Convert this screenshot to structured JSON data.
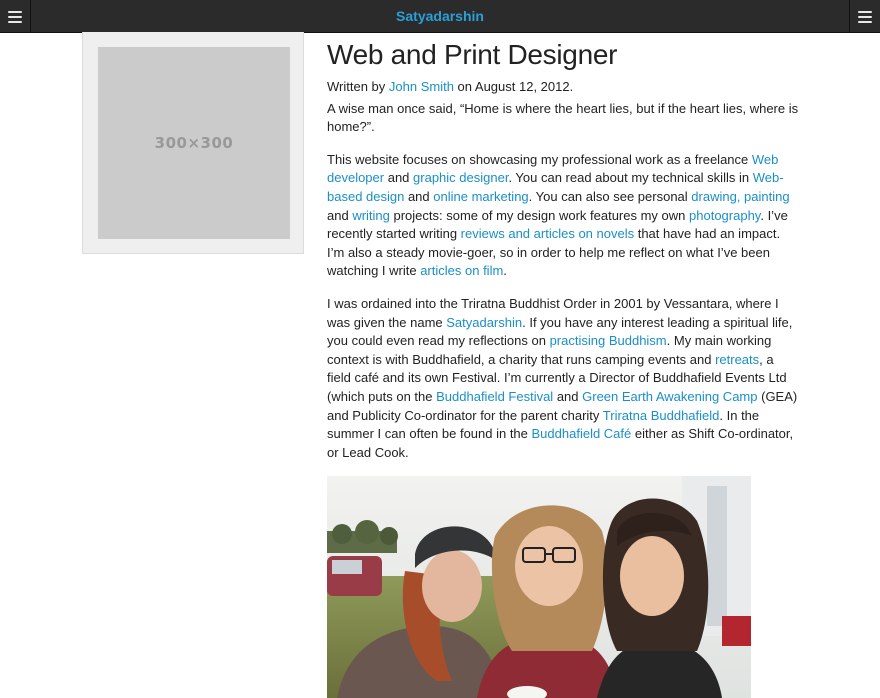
{
  "header": {
    "site_title": "Satyadarshin",
    "left_menu_icon": "hamburger-menu-icon",
    "right_menu_icon": "hamburger-menu-icon"
  },
  "sidebar": {
    "thumbnail_placeholder": "300×300"
  },
  "article": {
    "title": "Web and Print Designer",
    "byline_prefix": "Written by ",
    "author": "John Smith",
    "byline_date": " on August 12, 2012.",
    "intro": "A wise man once said, “Home is where the heart lies, but if the heart lies, where is home?”.",
    "p2": {
      "t1": "This website focuses on showcasing my professional work as a freelance ",
      "l1": "Web developer",
      "t2": " and ",
      "l2": "graphic designer",
      "t3": ". You can read about my technical skills in ",
      "l3": "Web-based design",
      "t4": " and ",
      "l4": "online marketing",
      "t5": ". You can also see personal ",
      "l5": "drawing, painting",
      "t6": " and ",
      "l6": "writing",
      "t7": " projects: some of my design work features my own ",
      "l7": "photography",
      "t8": ". I’ve recently started writing ",
      "l8": "reviews and articles on novels",
      "t9": " that have had an impact. I’m also a steady movie-goer, so in order to help me reflect on what I’ve been watching I write ",
      "l9": "articles on film",
      "t10": "."
    },
    "p3": {
      "t1": "I was ordained into the Triratna Buddhist Order in 2001 by Vessantara, where I was given the name ",
      "l1": "Satyadarshin",
      "t2": ". If you have any interest leading a spiritual life, you could even read my reflections on ",
      "l2": "practising Buddhism",
      "t3": ". My main working context is with Buddhafield, a charity that runs camping events and ",
      "l3": "retreats",
      "t4": ", a field café and its own Festival. I’m currently a Director of Buddhafield Events Ltd (which puts on the ",
      "l4": "Buddhafield Festival",
      "t5": " and ",
      "l5": "Green Earth Awakening Camp",
      "t6": " (GEA) and Publicity Co-ordinator for the parent charity ",
      "l6": "Triratna Buddhafield",
      "t7": ". In the summer I can often be found in the ",
      "l7": "Buddhafield Café",
      "t8": " either as Shift Co-ordinator, or Lead Cook."
    }
  },
  "colors": {
    "header_bg": "#2b2b2b",
    "accent": "#2aa0d6",
    "link": "#1a8fc7"
  }
}
